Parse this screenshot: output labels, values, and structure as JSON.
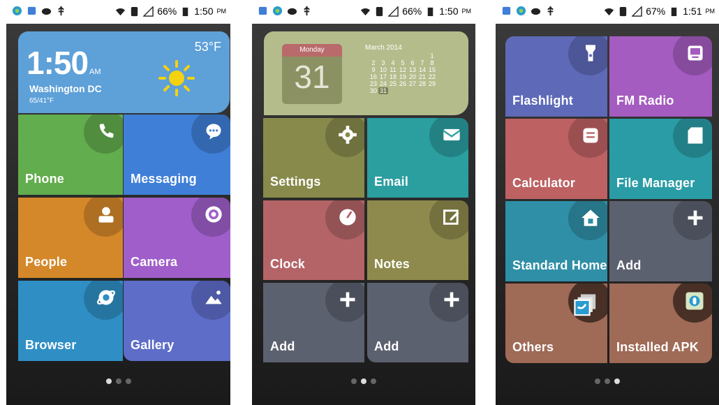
{
  "colors": {
    "phone": "#62ad4d",
    "messaging": "#3f7fd7",
    "people": "#d5882a",
    "camera": "#9f5ec9",
    "browser": "#2f8fc5",
    "gallery": "#5e6dc8",
    "settings": "#888a4c",
    "email": "#2b9ea0",
    "clock": "#b46467",
    "notes": "#8e8a4d",
    "add": "#5c6170",
    "flashlight": "#5e6ab8",
    "fm": "#a45cc0",
    "calculator": "#bd6163",
    "filemanager": "#2a9ca5",
    "standardhome": "#2f8fa7",
    "others": "#9f6a56",
    "apk": "#9f6a56"
  },
  "screen1": {
    "status": {
      "battery": "66%",
      "time": "1:50",
      "ampm": "PM"
    },
    "weather": {
      "time": "1:50",
      "am": "AM",
      "city": "Washington DC",
      "range": "65/41°F",
      "temp": "53°F"
    },
    "tiles": [
      {
        "label": "Phone",
        "icon": "phone-icon"
      },
      {
        "label": "Messaging",
        "icon": "chat-bubble-icon"
      },
      {
        "label": "People",
        "icon": "person-icon"
      },
      {
        "label": "Camera",
        "icon": "camera-icon"
      },
      {
        "label": "Browser",
        "icon": "browser-icon"
      },
      {
        "label": "Gallery",
        "icon": "gallery-icon"
      }
    ]
  },
  "screen2": {
    "status": {
      "battery": "66%",
      "time": "1:50",
      "ampm": "PM"
    },
    "calendar": {
      "weekday": "Monday",
      "day": "31",
      "month": "March 2014",
      "rows": [
        [
          "",
          "",
          "",
          "",
          "",
          "",
          "1"
        ],
        [
          "2",
          "3",
          "4",
          "5",
          "6",
          "7",
          "8"
        ],
        [
          "9",
          "10",
          "11",
          "12",
          "13",
          "14",
          "15"
        ],
        [
          "16",
          "17",
          "18",
          "19",
          "20",
          "21",
          "22"
        ],
        [
          "23",
          "24",
          "25",
          "26",
          "27",
          "28",
          "29"
        ],
        [
          "30",
          "31",
          "",
          "",
          "",
          "",
          ""
        ]
      ]
    },
    "tiles": [
      {
        "label": "Settings",
        "icon": "gear-icon"
      },
      {
        "label": "Email",
        "icon": "envelope-icon"
      },
      {
        "label": "Clock",
        "icon": "clock-icon"
      },
      {
        "label": "Notes",
        "icon": "notes-icon"
      },
      {
        "label": "Add",
        "icon": "plus-icon"
      },
      {
        "label": "Add",
        "icon": "plus-icon"
      }
    ]
  },
  "screen3": {
    "status": {
      "battery": "67%",
      "time": "1:51",
      "ampm": "PM"
    },
    "tiles": [
      {
        "label": "Flashlight",
        "icon": "flashlight-icon"
      },
      {
        "label": "FM Radio",
        "icon": "radio-icon"
      },
      {
        "label": "Calculator",
        "icon": "calculator-icon"
      },
      {
        "label": "File Manager",
        "icon": "folder-icon"
      },
      {
        "label": "Standard Home",
        "icon": "home-icon"
      },
      {
        "label": "Add",
        "icon": "plus-icon"
      },
      {
        "label": "Others",
        "icon": "app-stack-icon"
      },
      {
        "label": "Installed APK",
        "icon": "apk-icon"
      }
    ]
  }
}
